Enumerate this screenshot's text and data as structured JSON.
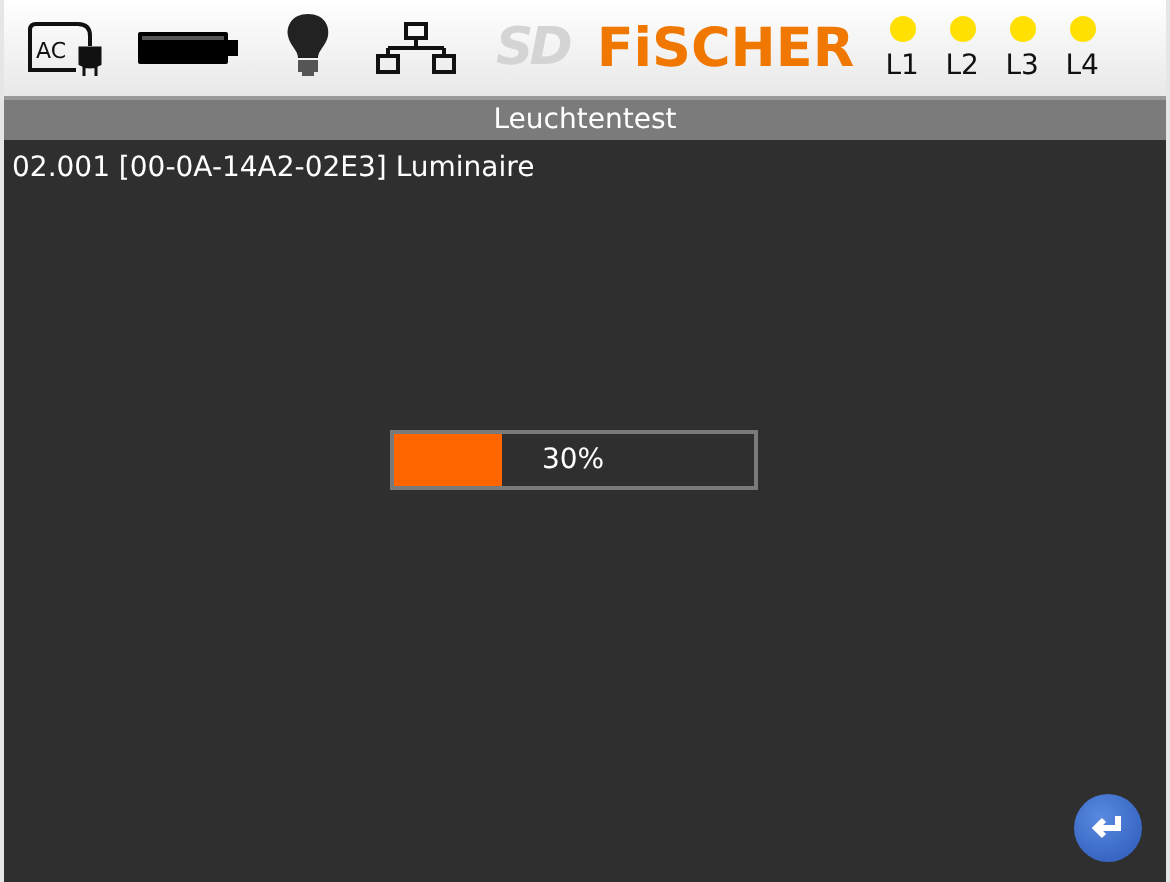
{
  "header": {
    "ac_label": "AC",
    "sd_logo": "SD",
    "brand": "FiSCHER",
    "leds": [
      {
        "label": "L1",
        "color": "#ffe000"
      },
      {
        "label": "L2",
        "color": "#ffe000"
      },
      {
        "label": "L3",
        "color": "#ffe000"
      },
      {
        "label": "L4",
        "color": "#ffe000"
      }
    ]
  },
  "title": "Leuchtentest",
  "device_line": "02.001 [00-0A-14A2-02E3] Luminaire",
  "progress": {
    "level": 0.3,
    "reading": "30%"
  }
}
